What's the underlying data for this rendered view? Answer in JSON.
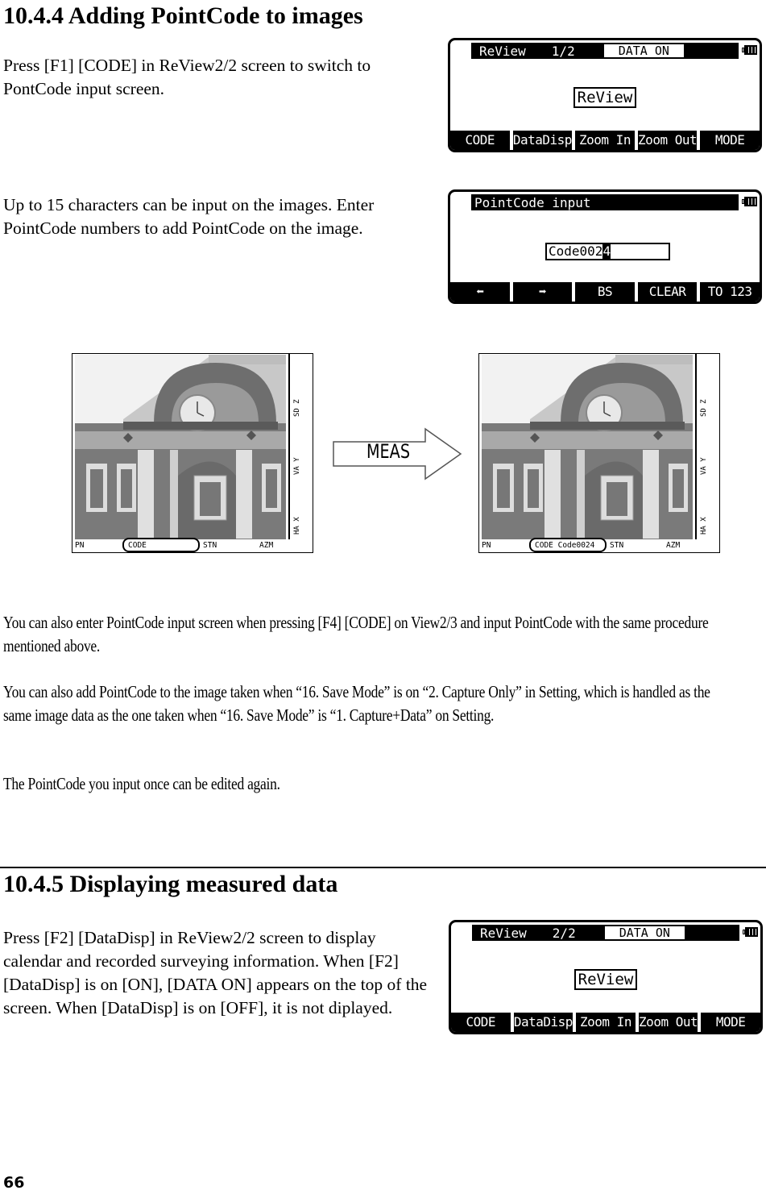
{
  "section_1": {
    "heading": "10.4.4 Adding PointCode to images",
    "para_1": "Press [F1] [CODE] in ReView2/2 screen to switch to PontCode input screen.",
    "para_2": "Up to 15 characters can be input on the images. Enter PointCode numbers to add PointCode on the image.",
    "para_3": "You can also enter PointCode input screen when pressing [F4] [CODE] on View2/3 and input PointCode with the same procedure mentioned above.",
    "para_4": "You can also add  PointCode to the image taken when “16. Save Mode” is on “2. Capture Only” in Setting, which is handled as the same image data as the one taken when “16. Save Mode” is “1. Capture+Data” on Setting.",
    "para_5": "The PointCode you input once can be edited again."
  },
  "screen_review_1": {
    "title": "ReView",
    "page": "1/2",
    "data_badge": "DATA ON",
    "battery_icon": "battery-full-icon",
    "center_label": "ReView",
    "fkeys": [
      "CODE",
      "DataDisp",
      "Zoom In",
      "Zoom Out",
      "MODE"
    ]
  },
  "screen_pointcode": {
    "title": "PointCode input",
    "battery_icon": "battery-full-icon",
    "input_value": "Code002",
    "input_cursor_char": "4",
    "fkeys": [
      "🡄",
      "🡆",
      "BS",
      "CLEAR",
      "TO 123"
    ],
    "fkey_icons": [
      "arrow-left-icon",
      "arrow-right-icon"
    ]
  },
  "photo_before": {
    "side_labels": [
      "SD Z",
      "VA Y",
      "HA X"
    ],
    "bottom_labels": {
      "pn": "PN",
      "code": "CODE",
      "stn": "STN",
      "azm": "AZM"
    }
  },
  "arrow": {
    "label": "MEAS"
  },
  "photo_after": {
    "side_labels": [
      "SD Z",
      "VA Y",
      "HA X"
    ],
    "bottom_labels": {
      "pn": "PN",
      "code": "CODE Code0024",
      "stn": "STN",
      "azm": "AZM"
    }
  },
  "section_2": {
    "heading": "10.4.5 Displaying measured data",
    "para_1": "Press [F2] [DataDisp] in ReView2/2 screen to display calendar and recorded surveying information. When [F2] [DataDisp] is on [ON], [DATA ON] appears on the top of the screen. When [DataDisp] is on [OFF], it is not diplayed."
  },
  "screen_review_2": {
    "title": "ReView",
    "page": "2/2",
    "data_badge": "DATA ON",
    "battery_icon": "battery-full-icon",
    "center_label": "ReView",
    "fkeys": [
      "CODE",
      "DataDisp",
      "Zoom In",
      "Zoom Out",
      "MODE"
    ]
  },
  "page_number": "66"
}
